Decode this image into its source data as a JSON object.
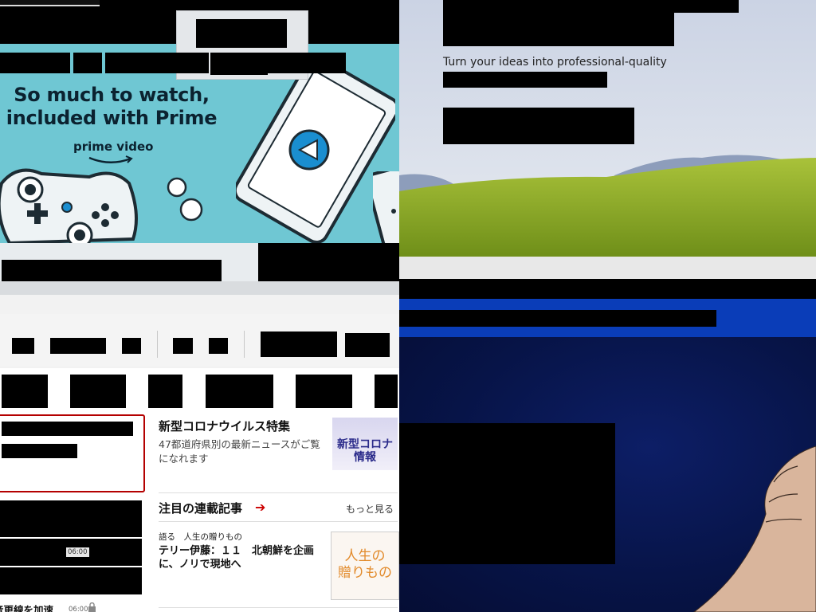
{
  "colors": {
    "prime_teal": "#6fc7d3",
    "prime_navy": "#0b2230",
    "news_red": "#b40000",
    "slide_blue": "#0a3db8",
    "slide_navy": "#071448"
  },
  "prime_promo": {
    "headline_line1": "So much to watch,",
    "headline_line2": "included with Prime",
    "logo_text": "prime video",
    "icons": [
      "play-button-icon",
      "game-controller-icon",
      "popcorn-icon"
    ]
  },
  "slide_top": {
    "subtitle": "Turn your ideas into professional-quality"
  },
  "news": {
    "corona": {
      "title": "新型コロナウイルス特集",
      "description": "47都道府県別の最新ニュースがご覧になれます",
      "thumb_text_line1": "新型コロナ",
      "thumb_text_line2": "情報"
    },
    "featured": {
      "title": "注目の連載記事",
      "arrow": "➔",
      "more_link": "もっと見る"
    },
    "article": {
      "category": "語る　人生の贈りもの",
      "title": "テリー伊藤：１１　北朝鮮を企画に、ノリで現地へ",
      "thumb_text_line1": "人生の",
      "thumb_text_line2": "贈りもの"
    },
    "side_list": {
      "time_badge_1": "06:00",
      "partial_headline": "音更線を加速",
      "time_badge_2": "06:00"
    }
  }
}
